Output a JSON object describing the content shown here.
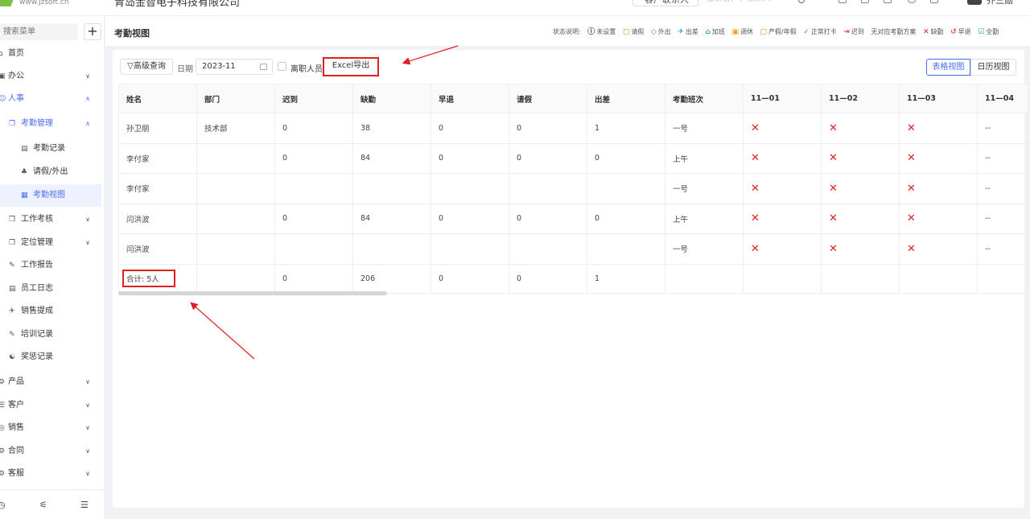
{
  "topbar": {
    "site_url": "www.jzsoft.cn",
    "company": "青岛金智电子科技有限公司",
    "top_button": "客户联系人",
    "search_placeholder": "搜索客户、联系人",
    "username": "乔三勋"
  },
  "sidebar": {
    "search_placeholder": "搜索菜单",
    "add_label": "+",
    "items": [
      {
        "label": "首页",
        "icon": "home-icon",
        "glyph": "⌂"
      },
      {
        "label": "办公",
        "icon": "office-icon",
        "glyph": "▣"
      },
      {
        "label": "人事",
        "icon": "personnel-icon",
        "glyph": "☺"
      },
      {
        "label": "考勤管理",
        "icon": "attendance-icon",
        "glyph": "❐"
      },
      {
        "label": "考勤记录",
        "icon": "record-icon",
        "glyph": "▤"
      },
      {
        "label": "请假/外出",
        "icon": "leave-icon",
        "glyph": "♣"
      },
      {
        "label": "考勤视图",
        "icon": "view-icon",
        "glyph": "▦"
      },
      {
        "label": "工作考核",
        "icon": "assessment-icon",
        "glyph": "❐"
      },
      {
        "label": "定位管理",
        "icon": "location-icon",
        "glyph": "❐"
      },
      {
        "label": "工作报告",
        "icon": "report-icon",
        "glyph": "✎"
      },
      {
        "label": "员工日志",
        "icon": "log-icon",
        "glyph": "▤"
      },
      {
        "label": "销售提成",
        "icon": "commission-icon",
        "glyph": "✈"
      },
      {
        "label": "培训记录",
        "icon": "training-icon",
        "glyph": "✎"
      },
      {
        "label": "奖惩记录",
        "icon": "reward-icon",
        "glyph": "☯"
      },
      {
        "label": "产品",
        "icon": "product-icon",
        "glyph": "⚙"
      },
      {
        "label": "客户",
        "icon": "customer-icon",
        "glyph": "☰"
      },
      {
        "label": "销售",
        "icon": "sales-icon",
        "glyph": "◎"
      },
      {
        "label": "合同",
        "icon": "contract-icon",
        "glyph": "⚙"
      },
      {
        "label": "客服",
        "icon": "service-icon",
        "glyph": "⚙"
      }
    ]
  },
  "header": {
    "title": "考勤视图",
    "legend_title": "状态说明:",
    "legend": [
      {
        "icon": "ⓘ",
        "label": "未设置",
        "color": "#333333"
      },
      {
        "icon": "▢",
        "label": "请假",
        "color": "#e67e22"
      },
      {
        "icon": "◇",
        "label": "外出",
        "color": "#9b59b6"
      },
      {
        "icon": "✈",
        "label": "出差",
        "color": "#3498db"
      },
      {
        "icon": "⌂",
        "label": "加班",
        "color": "#3498db"
      },
      {
        "icon": "▣",
        "label": "调休",
        "color": "#f39c12"
      },
      {
        "icon": "▢",
        "label": "产假/年假",
        "color": "#e67e22"
      },
      {
        "icon": "✓",
        "label": "正常打卡",
        "color": "#27ae60"
      },
      {
        "icon": "⇥",
        "label": "迟到",
        "color": "#e74c3c"
      },
      {
        "icon": "",
        "label": "无对应考勤方案",
        "color": "#333333"
      },
      {
        "icon": "✕",
        "label": "缺勤",
        "color": "#e02020"
      },
      {
        "icon": "↺",
        "label": "早退",
        "color": "#e74c3c"
      },
      {
        "icon": "☑",
        "label": "全勤",
        "color": "#27ae60"
      }
    ]
  },
  "toolbar": {
    "advanced_query": "▽高级查询",
    "date_label": "日期",
    "date_value": "2023-11",
    "resigned_label": "离职人员",
    "export_label": "Excel导出",
    "table_view": "表格视图",
    "calendar_view": "日历视图"
  },
  "table": {
    "columns": [
      "姓名",
      "部门",
      "迟到",
      "缺勤",
      "早退",
      "请假",
      "出差",
      "考勤班次",
      "11—01",
      "11—02",
      "11—03",
      "11—04"
    ],
    "rows": [
      [
        "孙卫朋",
        "技术部",
        "0",
        "38",
        "0",
        "0",
        "1",
        "一号",
        "✕",
        "✕",
        "✕",
        "--"
      ],
      [
        "李付家",
        "",
        "0",
        "84",
        "0",
        "0",
        "0",
        "上午",
        "✕",
        "✕",
        "✕",
        "--"
      ],
      [
        "李付家",
        "",
        "",
        "",
        "",
        "",
        "",
        "一号",
        "✕",
        "✕",
        "✕",
        "--"
      ],
      [
        "闫洪波",
        "",
        "0",
        "84",
        "0",
        "0",
        "0",
        "上午",
        "✕",
        "✕",
        "✕",
        "--"
      ],
      [
        "闫洪波",
        "",
        "",
        "",
        "",
        "",
        "",
        "一号",
        "✕",
        "✕",
        "✕",
        "--"
      ]
    ],
    "total": [
      "合计: 5人",
      "",
      "0",
      "206",
      "0",
      "0",
      "1",
      "",
      "",
      "",
      "",
      ""
    ]
  }
}
